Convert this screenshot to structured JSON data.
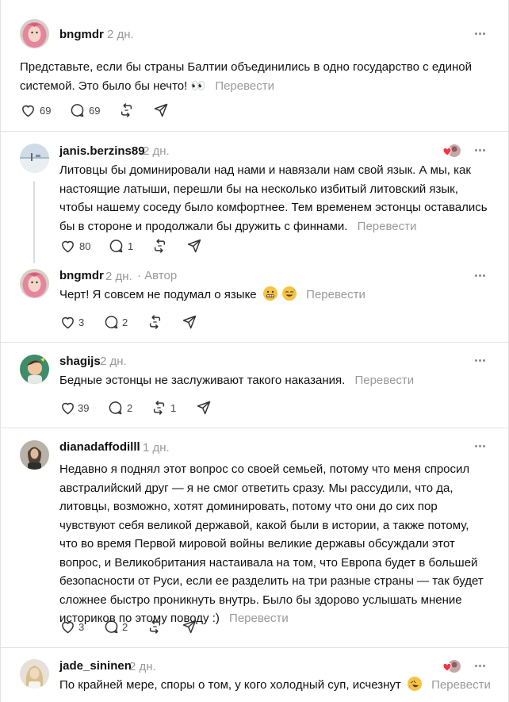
{
  "icons": {
    "like": "heart-outline-icon",
    "reply": "speech-bubble-icon",
    "repost": "repost-arrows-icon",
    "share": "paper-plane-icon",
    "more": "more-horizontal-icon",
    "author_liked": "author-liked-heart-avatar-icon"
  },
  "colors": {
    "text": "#101010",
    "muted": "#999999",
    "divider": "#e2e2e2",
    "liked_heart": "#ff3040"
  },
  "posts": [
    {
      "username": "bngmdr",
      "time": "2 дн.",
      "text": "Представьте, если бы страны Балтии объединились в одно государство с единой системой. Это было бы нечто! 👀",
      "translate": "Перевести",
      "likes": "69",
      "replies": "69",
      "reposts": "",
      "avatar": "pink-haired-avatar"
    },
    {
      "username": "janis.berzins89",
      "time": "2 дн.",
      "text": "Литовцы бы доминировали над нами и навязали нам свой язык. А мы, как настоящие латыши, перешли бы на несколько избитый литовский язык, чтобы нашему соседу было комфортнее. Тем временем эстонцы оставались бы в стороне и продолжали бы дружить с финнами.",
      "translate": "Перевести",
      "likes": "80",
      "replies": "1",
      "reposts": "",
      "avatar": "seaside-photo-avatar"
    },
    {
      "username": "bngmdr",
      "time": "2 дн.",
      "author_label": "· Автор",
      "text": "Черт! Я совсем не подумал о языке",
      "translate": "Перевести",
      "likes": "3",
      "replies": "2",
      "reposts": "",
      "avatar": "pink-haired-avatar"
    },
    {
      "username": "shagijs",
      "time": "2 дн.",
      "text": "Бедные эстонцы не заслуживают такого наказания.",
      "translate": "Перевести",
      "likes": "39",
      "replies": "2",
      "reposts": "1",
      "avatar": "cartoon-avatar"
    },
    {
      "username": "dianadaffodilll",
      "time": "1 дн.",
      "text": "Недавно я поднял этот вопрос со своей семьей, потому что меня спросил австралийский друг — я не смог ответить сразу. Мы рассудили, что да, литовцы, возможно, хотят доминировать, потому что они до сих пор чувствуют себя великой державой, какой были в истории, а также потому, что во время Первой мировой войны великие державы обсуждали этот вопрос, и Великобритания настаивала на том, что Европа будет в большей безопасности от Руси, если ее разделить на три разные страны — так будет сложнее быстро проникнуть внутрь. Было бы здорово услышать мнение историков по этому поводу :)",
      "translate": "Перевести",
      "likes": "3",
      "replies": "2",
      "reposts": "",
      "avatar": "portrait-avatar"
    },
    {
      "username": "jade_sininen",
      "time": "2 дн.",
      "text": "По крайней мере, споры о том, у кого холодный суп, исчезнут",
      "translate": "Перевести",
      "avatar": "blonde-avatar"
    }
  ]
}
